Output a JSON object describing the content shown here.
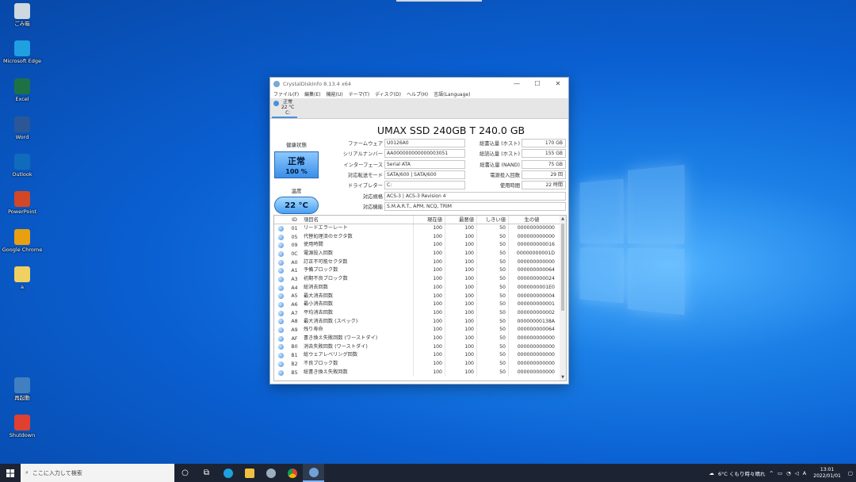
{
  "desktop": {
    "icons": [
      {
        "label": "ごみ箱",
        "icon": "recycle-bin-icon",
        "color": "#cfd8e0"
      },
      {
        "label": "Microsoft Edge",
        "icon": "edge-icon",
        "color": "#1fa0e0"
      },
      {
        "label": "Excel",
        "icon": "excel-icon",
        "color": "#1e7145"
      },
      {
        "label": "Word",
        "icon": "word-icon",
        "color": "#2b5797"
      },
      {
        "label": "Outlook",
        "icon": "outlook-icon",
        "color": "#0f6cbd"
      },
      {
        "label": "PowerPoint",
        "icon": "powerpoint-icon",
        "color": "#d24726"
      },
      {
        "label": "Google Chrome",
        "icon": "chrome-icon",
        "color": "#e8a010"
      },
      {
        "label": "a",
        "icon": "file-icon",
        "color": "#f0d060"
      },
      {
        "label": "再起動",
        "icon": "restart-icon",
        "color": "#4080c0"
      },
      {
        "label": "Shutdown",
        "icon": "shutdown-icon",
        "color": "#e04030"
      }
    ]
  },
  "window": {
    "title": "CrystalDiskInfo 8.13.4 x64",
    "menu": [
      "ファイル(F)",
      "編集(E)",
      "機能(U)",
      "テーマ(T)",
      "ディスク(D)",
      "ヘルプ(H)",
      "言語(Language)"
    ],
    "drive_tab": {
      "status": "正常",
      "temp": "22 °C",
      "letter": "C:"
    },
    "model": "UMAX SSD 240GB T 240.0 GB",
    "health": {
      "label": "健康状態",
      "status": "正常",
      "percent": "100 %"
    },
    "temperature": {
      "label": "温度",
      "value": "22 °C"
    },
    "info_left": [
      {
        "label": "ファームウェア",
        "value": "U0126A0"
      },
      {
        "label": "シリアルナンバー",
        "value": "AA000000000000003051"
      },
      {
        "label": "インターフェース",
        "value": "Serial ATA"
      },
      {
        "label": "対応転送モード",
        "value": "SATA/600 | SATA/600"
      },
      {
        "label": "ドライブレター",
        "value": "C:"
      }
    ],
    "info_right": [
      {
        "label": "総書込量 (ホスト)",
        "value": "170 GB"
      },
      {
        "label": "総読込量 (ホスト)",
        "value": "155 GB"
      },
      {
        "label": "総書込量 (NAND)",
        "value": "75 GB"
      },
      {
        "label": "電源投入回数",
        "value": "29 回"
      },
      {
        "label": "使用時間",
        "value": "22 時間"
      }
    ],
    "standard": {
      "label": "対応規格",
      "value": "ACS-3 | ACS-3 Revision 4"
    },
    "features": {
      "label": "対応機能",
      "value": "S.M.A.R.T., APM, NCQ, TRIM"
    },
    "table": {
      "headers": [
        "ID",
        "項目名",
        "現在値",
        "最悪値",
        "しきい値",
        "生の値"
      ],
      "rows": [
        [
          "01",
          "リードエラーレート",
          "100",
          "100",
          "50",
          "000000000000"
        ],
        [
          "05",
          "代替処理済のセクタ数",
          "100",
          "100",
          "50",
          "000000000000"
        ],
        [
          "09",
          "使用時間",
          "100",
          "100",
          "50",
          "000000000016"
        ],
        [
          "0C",
          "電源投入回数",
          "100",
          "100",
          "50",
          "00000000001D"
        ],
        [
          "A0",
          "訂正不可能セクタ数",
          "100",
          "100",
          "50",
          "000000000000"
        ],
        [
          "A1",
          "予備ブロック数",
          "100",
          "100",
          "50",
          "000000000064"
        ],
        [
          "A3",
          "初期不良ブロック数",
          "100",
          "100",
          "50",
          "000000000024"
        ],
        [
          "A4",
          "総消去回数",
          "100",
          "100",
          "50",
          "0000000001E0"
        ],
        [
          "A5",
          "最大消去回数",
          "100",
          "100",
          "50",
          "000000000004"
        ],
        [
          "A6",
          "最小消去回数",
          "100",
          "100",
          "50",
          "000000000001"
        ],
        [
          "A7",
          "平均消去回数",
          "100",
          "100",
          "50",
          "000000000002"
        ],
        [
          "A8",
          "最大消去回数 (スペック)",
          "100",
          "100",
          "50",
          "00000000138A"
        ],
        [
          "A9",
          "残り寿命",
          "100",
          "100",
          "50",
          "000000000064"
        ],
        [
          "AF",
          "書き換え失敗回数 (ワーストダイ)",
          "100",
          "100",
          "50",
          "000000000000"
        ],
        [
          "B0",
          "消去失敗回数 (ワーストダイ)",
          "100",
          "100",
          "50",
          "000000000000"
        ],
        [
          "B1",
          "総ウェアレベリング回数",
          "100",
          "100",
          "50",
          "000000000000"
        ],
        [
          "B2",
          "不良ブロック数",
          "100",
          "100",
          "50",
          "000000000000"
        ],
        [
          "B5",
          "総書き換え失敗回数",
          "100",
          "100",
          "50",
          "000000000000"
        ]
      ]
    }
  },
  "taskbar": {
    "search_placeholder": "ここに入力して検索",
    "weather": "6°C くもり時々晴れ",
    "ime": "A",
    "time": "13:01",
    "date": "2022/01/01"
  }
}
